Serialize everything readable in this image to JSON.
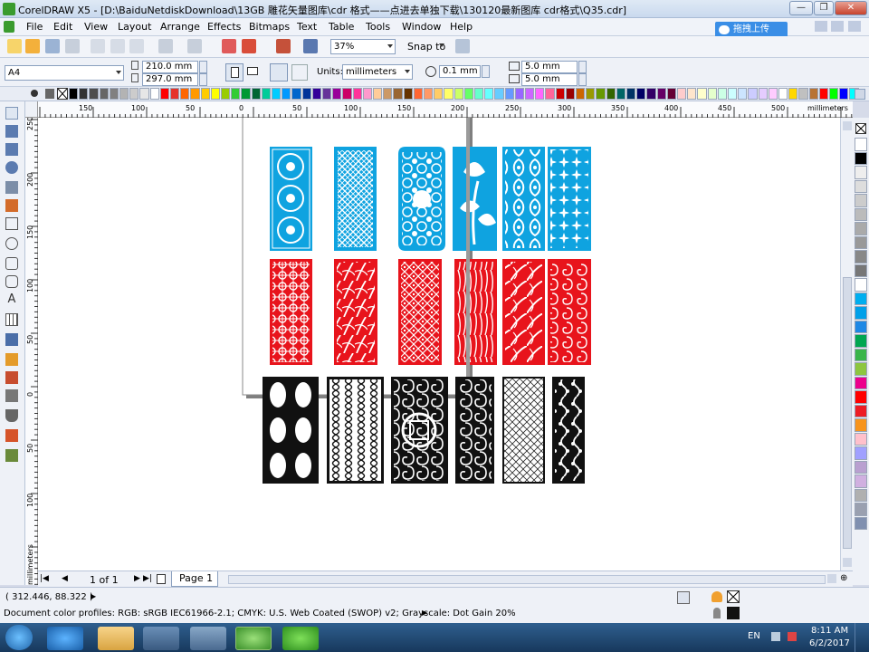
{
  "window": {
    "title": "CorelDRAW X5 - [D:\\BaiduNetdiskDownload\\13GB 雕花矢量图库\\cdr 格式——点进去单独下载\\130120最新图库 cdr格式\\Q35.cdr]",
    "minimize": "—",
    "restore": "❐",
    "close": "✕"
  },
  "menu": {
    "items": [
      "File",
      "Edit",
      "View",
      "Layout",
      "Arrange",
      "Effects",
      "Bitmaps",
      "Text",
      "Table",
      "Tools",
      "Window",
      "Help"
    ]
  },
  "cloud_button": {
    "label": "拖拽上传"
  },
  "standard_toolbar": {
    "zoom_value": "37%",
    "snap_label": "Snap to"
  },
  "property_bar": {
    "paper_size": "A4",
    "width": "210.0 mm",
    "height": "297.0 mm",
    "units_label": "Units:",
    "units_value": "millimeters",
    "nudge": "0.1 mm",
    "dup_x": "5.0 mm",
    "dup_y": "5.0 mm"
  },
  "palette": {
    "colors": [
      "#000000",
      "#333333",
      "#4d4d4d",
      "#666666",
      "#808080",
      "#b3b3b3",
      "#cccccc",
      "#e6e6e6",
      "#ffffff",
      "#ff0000",
      "#e6332a",
      "#ff6600",
      "#ff9900",
      "#ffcc00",
      "#ffff00",
      "#99cc00",
      "#33cc33",
      "#009933",
      "#006633",
      "#00cc99",
      "#00ccff",
      "#0099ff",
      "#0066cc",
      "#003399",
      "#330099",
      "#663399",
      "#990099",
      "#cc0066",
      "#ff3399",
      "#ff99cc",
      "#ffcc99",
      "#cc9966",
      "#996633",
      "#663300",
      "#ff6633",
      "#ff9966",
      "#ffcc66",
      "#ffff66",
      "#ccff66",
      "#66ff66",
      "#66ffcc",
      "#66ffff",
      "#66ccff",
      "#6699ff",
      "#9966ff",
      "#cc66ff",
      "#ff66ff",
      "#ff6699",
      "#cc0000",
      "#990000",
      "#cc6600",
      "#999900",
      "#669900",
      "#336600",
      "#006666",
      "#003366",
      "#000066",
      "#330066",
      "#660066",
      "#660033",
      "#ffcccc",
      "#ffe5cc",
      "#ffffcc",
      "#e5ffcc",
      "#ccffe5",
      "#ccffff",
      "#cce5ff",
      "#ccccff",
      "#e5ccff",
      "#ffccff",
      "#ffffff",
      "#ffd700",
      "#c0c0c0",
      "#b87333",
      "#ff0000",
      "#00ff00",
      "#0000ff",
      "#00ffff"
    ]
  },
  "vertical_palette": {
    "colors": [
      "#ffffff",
      "#000000",
      "#eeeeee",
      "#dddddd",
      "#cccccc",
      "#bbbbbb",
      "#aaaaaa",
      "#999999",
      "#888888",
      "#777777",
      "#ffffff",
      "#00aeef",
      "#00a0e9",
      "#1e88e5",
      "#00a651",
      "#39b54a",
      "#8dc63f",
      "#ec008c",
      "#ff0000",
      "#ed1c24",
      "#f7941d",
      "#ffc0cb",
      "#a0a0ff",
      "#b9a0d0",
      "#d0b0e0",
      "#b0b0b0",
      "#9aa0b0",
      "#8090b0"
    ]
  },
  "rulers": {
    "h_labels": [
      "150",
      "100",
      "50",
      "0",
      "50",
      "100",
      "150",
      "200",
      "250",
      "300",
      "350",
      "400",
      "450",
      "500",
      "millimeters"
    ],
    "v_labels": [
      "250",
      "200",
      "150",
      "100",
      "50",
      "0",
      "50",
      "100",
      "millimeters"
    ]
  },
  "pagebar": {
    "page_counter": "1 of 1",
    "tab": "Page 1"
  },
  "status": {
    "coords": "( 312.446, 88.322 )",
    "profiles": "Document color profiles: RGB: sRGB IEC61966-2.1; CMYK: U.S. Web Coated (SWOP) v2; Grayscale: Dot Gain 20%"
  },
  "taskbar": {
    "lang": "EN",
    "time": "8:11 AM",
    "date": "6/2/2017"
  },
  "colors": {
    "blue_panel": "#0fa3e0",
    "red_panel": "#e8141c",
    "black_panel": "#111111"
  },
  "panels": {
    "row1": [
      "flower-medallion",
      "lattice",
      "baroque",
      "lotus",
      "ornament",
      "floral"
    ],
    "row2": [
      "quatrefoil",
      "bamboo-leaves",
      "diamond-lattice",
      "reeds",
      "orchid",
      "scroll-ornament"
    ],
    "row3": [
      "ovals",
      "ogee",
      "longevity-seal",
      "scrolls",
      "fine-lattice",
      "vine"
    ]
  }
}
